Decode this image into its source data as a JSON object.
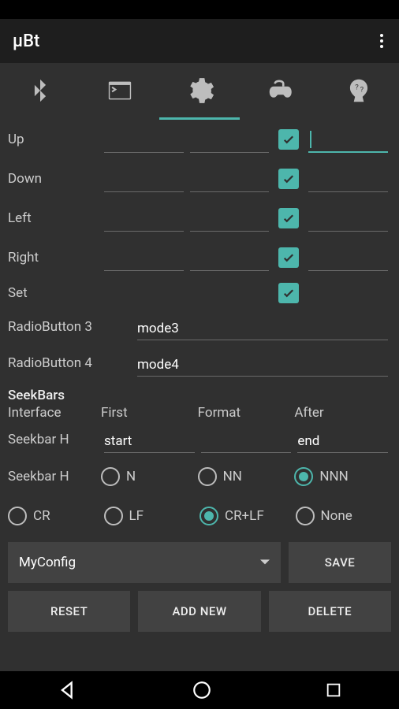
{
  "app": {
    "title": "μBt"
  },
  "tabs": {
    "active_index": 2,
    "icons": [
      "bluetooth",
      "terminal",
      "settings",
      "gamepad",
      "help"
    ]
  },
  "directions": {
    "rows": [
      {
        "label": "Up",
        "checked": true,
        "input_active": true
      },
      {
        "label": "Down",
        "checked": true,
        "input_active": false
      },
      {
        "label": "Left",
        "checked": true,
        "input_active": false
      },
      {
        "label": "Right",
        "checked": true,
        "input_active": false
      },
      {
        "label": "Set",
        "checked": true,
        "input_active": false
      }
    ]
  },
  "radiobuttons": [
    {
      "label": "RadioButton 3",
      "value": "mode3"
    },
    {
      "label": "RadioButton 4",
      "value": "mode4"
    }
  ],
  "seekbars": {
    "section": "SeekBars",
    "headers": {
      "col1": "Interface",
      "col2": "First",
      "col3": "Format",
      "col4": "After"
    },
    "row1": {
      "label": "Seekbar H",
      "first": "start",
      "format": "",
      "after": "end"
    },
    "row2": {
      "label": "Seekbar H",
      "options": [
        "N",
        "NN",
        "NNN"
      ],
      "selected": "NNN"
    }
  },
  "lineend": {
    "options": [
      "CR",
      "LF",
      "CR+LF",
      "None"
    ],
    "selected": "CR+LF"
  },
  "config": {
    "name": "MyConfig",
    "save_label": "Save",
    "reset_label": "Reset",
    "addnew_label": "Add New",
    "delete_label": "Delete"
  }
}
